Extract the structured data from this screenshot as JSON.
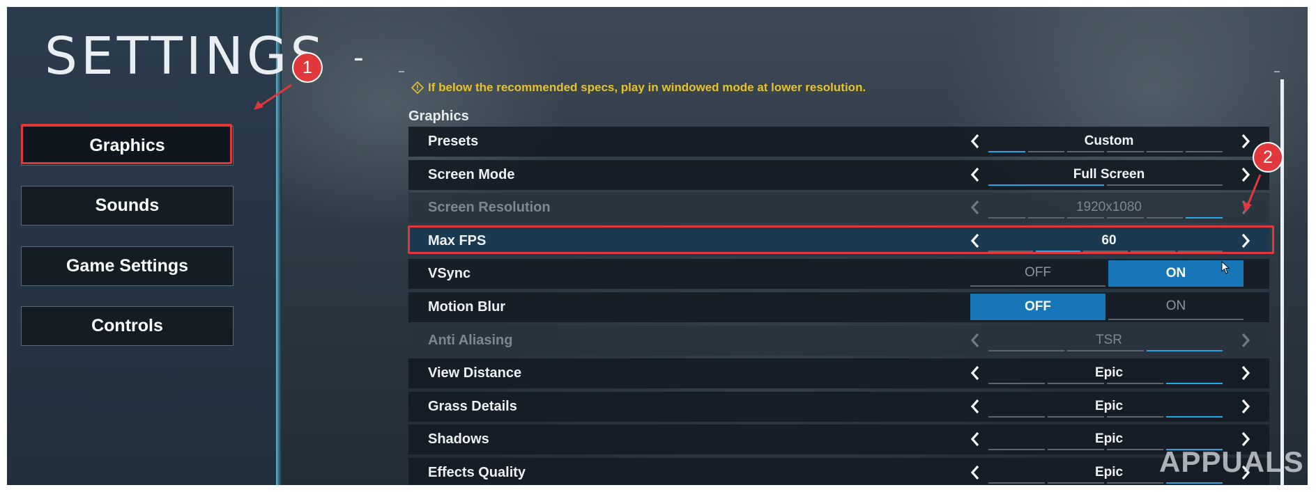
{
  "header": {
    "title": "SETTINGS",
    "dash": "-"
  },
  "sidebar": {
    "items": [
      {
        "label": "Graphics",
        "active": true
      },
      {
        "label": "Sounds",
        "active": false
      },
      {
        "label": "Game Settings",
        "active": false
      },
      {
        "label": "Controls",
        "active": false
      }
    ]
  },
  "notice": {
    "text": "If below the recommended specs, play in windowed mode at lower resolution."
  },
  "section": {
    "title": "Graphics"
  },
  "settings": [
    {
      "label": "Presets",
      "value": "Custom",
      "disabled": false
    },
    {
      "label": "Screen Mode",
      "value": "Full Screen",
      "disabled": false
    },
    {
      "label": "Screen Resolution",
      "value": "1920x1080",
      "disabled": true
    },
    {
      "label": "Max FPS",
      "value": "60",
      "disabled": false
    },
    {
      "label": "VSync",
      "off_label": "OFF",
      "on_label": "ON",
      "state": "ON"
    },
    {
      "label": "Motion Blur",
      "off_label": "OFF",
      "on_label": "ON",
      "state": "OFF"
    },
    {
      "label": "Anti Aliasing",
      "value": "TSR",
      "disabled": true
    },
    {
      "label": "View Distance",
      "value": "Epic",
      "disabled": false
    },
    {
      "label": "Grass Details",
      "value": "Epic",
      "disabled": false
    },
    {
      "label": "Shadows",
      "value": "Epic",
      "disabled": false
    },
    {
      "label": "Effects Quality",
      "value": "Epic",
      "disabled": false
    }
  ],
  "annotations": {
    "marker_1": "1",
    "marker_2": "2"
  },
  "watermark": {
    "text": "APPUALS"
  },
  "colors": {
    "accent": "#2aa6e6",
    "highlight": "#e0383b",
    "warning": "#e8c22e",
    "toggle_on": "#1676b8"
  }
}
